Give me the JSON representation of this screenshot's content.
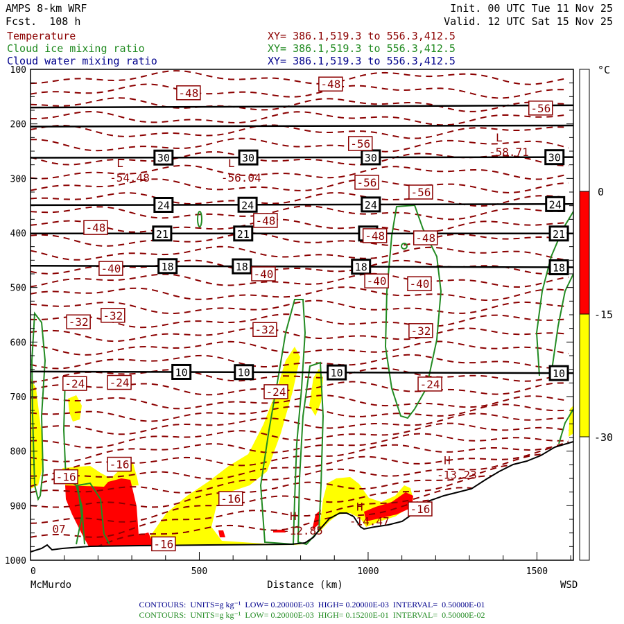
{
  "header": {
    "model": "AMPS 8-km WRF",
    "forecast": "Fcst.  108 h",
    "init": "Init. 00 UTC Tue 11 Nov 25",
    "valid": "Valid. 12 UTC Sat 15 Nov 25",
    "fields": [
      {
        "name": "Temperature",
        "xy": "XY= 386.1,519.3 to 556.3,412.5",
        "color": "#8b0000"
      },
      {
        "name": "Cloud ice mixing ratio",
        "xy": "XY= 386.1,519.3 to 556.3,412.5",
        "color": "#228b22"
      },
      {
        "name": "Cloud water mixing ratio",
        "xy": "XY= 386.1,519.3 to 556.3,412.5",
        "color": "#00008b"
      }
    ]
  },
  "footer": {
    "water": "CONTOURS:  UNITS=g kg⁻¹  LOW= 0.20000E-03  HIGH= 0.20000E-03  INTERVAL=  0.50000E-01",
    "ice": "CONTOURS:  UNITS=g kg⁻¹  LOW= 0.20000E-03  HIGH= 0.15200E-01  INTERVAL=  0.50000E-02"
  },
  "chart_data": {
    "type": "cross-section",
    "xlabel": "Distance (km)",
    "x_start_label": "McMurdo",
    "x_end_label": "WSD",
    "xlim": [
      0,
      1608
    ],
    "xticks": [
      0,
      500,
      1000,
      1500
    ],
    "ylim": [
      100,
      1000
    ],
    "yticks": [
      100,
      200,
      300,
      400,
      500,
      600,
      700,
      800,
      900,
      1000
    ],
    "colorbar": {
      "unit": "°C",
      "ticks": [
        "0",
        "-15",
        "-30"
      ],
      "bands": [
        {
          "from": 0,
          "to": -15,
          "color": "#ff0000"
        },
        {
          "from": -15,
          "to": -30,
          "color": "#ffff00"
        }
      ]
    },
    "colors": {
      "temperature": "#8b0000",
      "ice": "#228b22",
      "red": "#ff0000",
      "yellow": "#ffff00"
    },
    "temperature_labels": [
      {
        "text": "-48",
        "km": 468,
        "p": 143
      },
      {
        "text": "-48",
        "km": 889,
        "p": 127
      },
      {
        "text": "-56",
        "km": 1511,
        "p": 171
      },
      {
        "text": "-56",
        "km": 977,
        "p": 236
      },
      {
        "text": "-56",
        "km": 996,
        "p": 307
      },
      {
        "text": "-56",
        "km": 1156,
        "p": 325
      },
      {
        "text": "-48",
        "km": 193,
        "p": 390
      },
      {
        "text": "-48",
        "km": 696,
        "p": 377
      },
      {
        "text": "-48",
        "km": 1020,
        "p": 405
      },
      {
        "text": "-48",
        "km": 1170,
        "p": 409
      },
      {
        "text": "-40",
        "km": 238,
        "p": 465
      },
      {
        "text": "-40",
        "km": 690,
        "p": 475
      },
      {
        "text": "-40",
        "km": 1025,
        "p": 488
      },
      {
        "text": "-40",
        "km": 1152,
        "p": 493
      },
      {
        "text": "-32",
        "km": 142,
        "p": 563
      },
      {
        "text": "-32",
        "km": 244,
        "p": 551
      },
      {
        "text": "-32",
        "km": 694,
        "p": 577
      },
      {
        "text": "-32",
        "km": 1156,
        "p": 579
      },
      {
        "text": "-24",
        "km": 131,
        "p": 676
      },
      {
        "text": "-24",
        "km": 263,
        "p": 674
      },
      {
        "text": "-24",
        "km": 727,
        "p": 691
      },
      {
        "text": "-24",
        "km": 1183,
        "p": 677
      },
      {
        "text": "-16",
        "km": 263,
        "p": 824
      },
      {
        "text": "-16",
        "km": 105,
        "p": 847
      },
      {
        "text": "-16",
        "km": 593,
        "p": 887
      },
      {
        "text": "-16",
        "km": 394,
        "p": 970
      },
      {
        "text": "-16",
        "km": 1154,
        "p": 906
      }
    ],
    "extrema": [
      {
        "type": "L",
        "value": "-54.48",
        "km": 265,
        "p": 279
      },
      {
        "type": "L",
        "value": "-56.04",
        "km": 595,
        "p": 279
      },
      {
        "type": "L",
        "value": "-58.71",
        "km": 1388,
        "p": 232
      },
      {
        "type": "H",
        "value": "-12.85",
        "km": 778,
        "p": 926
      },
      {
        "type": "H",
        "value": "-14.47",
        "km": 975,
        "p": 909
      },
      {
        "type": "H",
        "value": "-13.23",
        "km": 1234,
        "p": 824
      }
    ],
    "partial_label": {
      "text": "07",
      "km": 44,
      "p": 950
    },
    "black_lines": [
      {
        "label": "",
        "p_left": 170,
        "p_right": 166,
        "label_km": []
      },
      {
        "label": "",
        "p_left": 205,
        "p_right": 203,
        "label_km": []
      },
      {
        "label": "30",
        "p_left": 262,
        "p_right": 261,
        "label_km": [
          394,
          645,
          1008,
          1552
        ]
      },
      {
        "label": "24",
        "p_left": 349,
        "p_right": 347,
        "label_km": [
          394,
          643,
          1008,
          1554
        ]
      },
      {
        "label": "21",
        "p_left": 401,
        "p_right": 401,
        "label_km": [
          390,
          630,
          1000,
          1565
        ]
      },
      {
        "label": "18",
        "p_left": 460,
        "p_right": 463,
        "label_km": [
          406,
          626,
          979,
          1565
        ]
      },
      {
        "label": "10",
        "p_left": 654,
        "p_right": 657,
        "label_km": [
          447,
          632,
          907,
          1565
        ]
      }
    ]
  }
}
